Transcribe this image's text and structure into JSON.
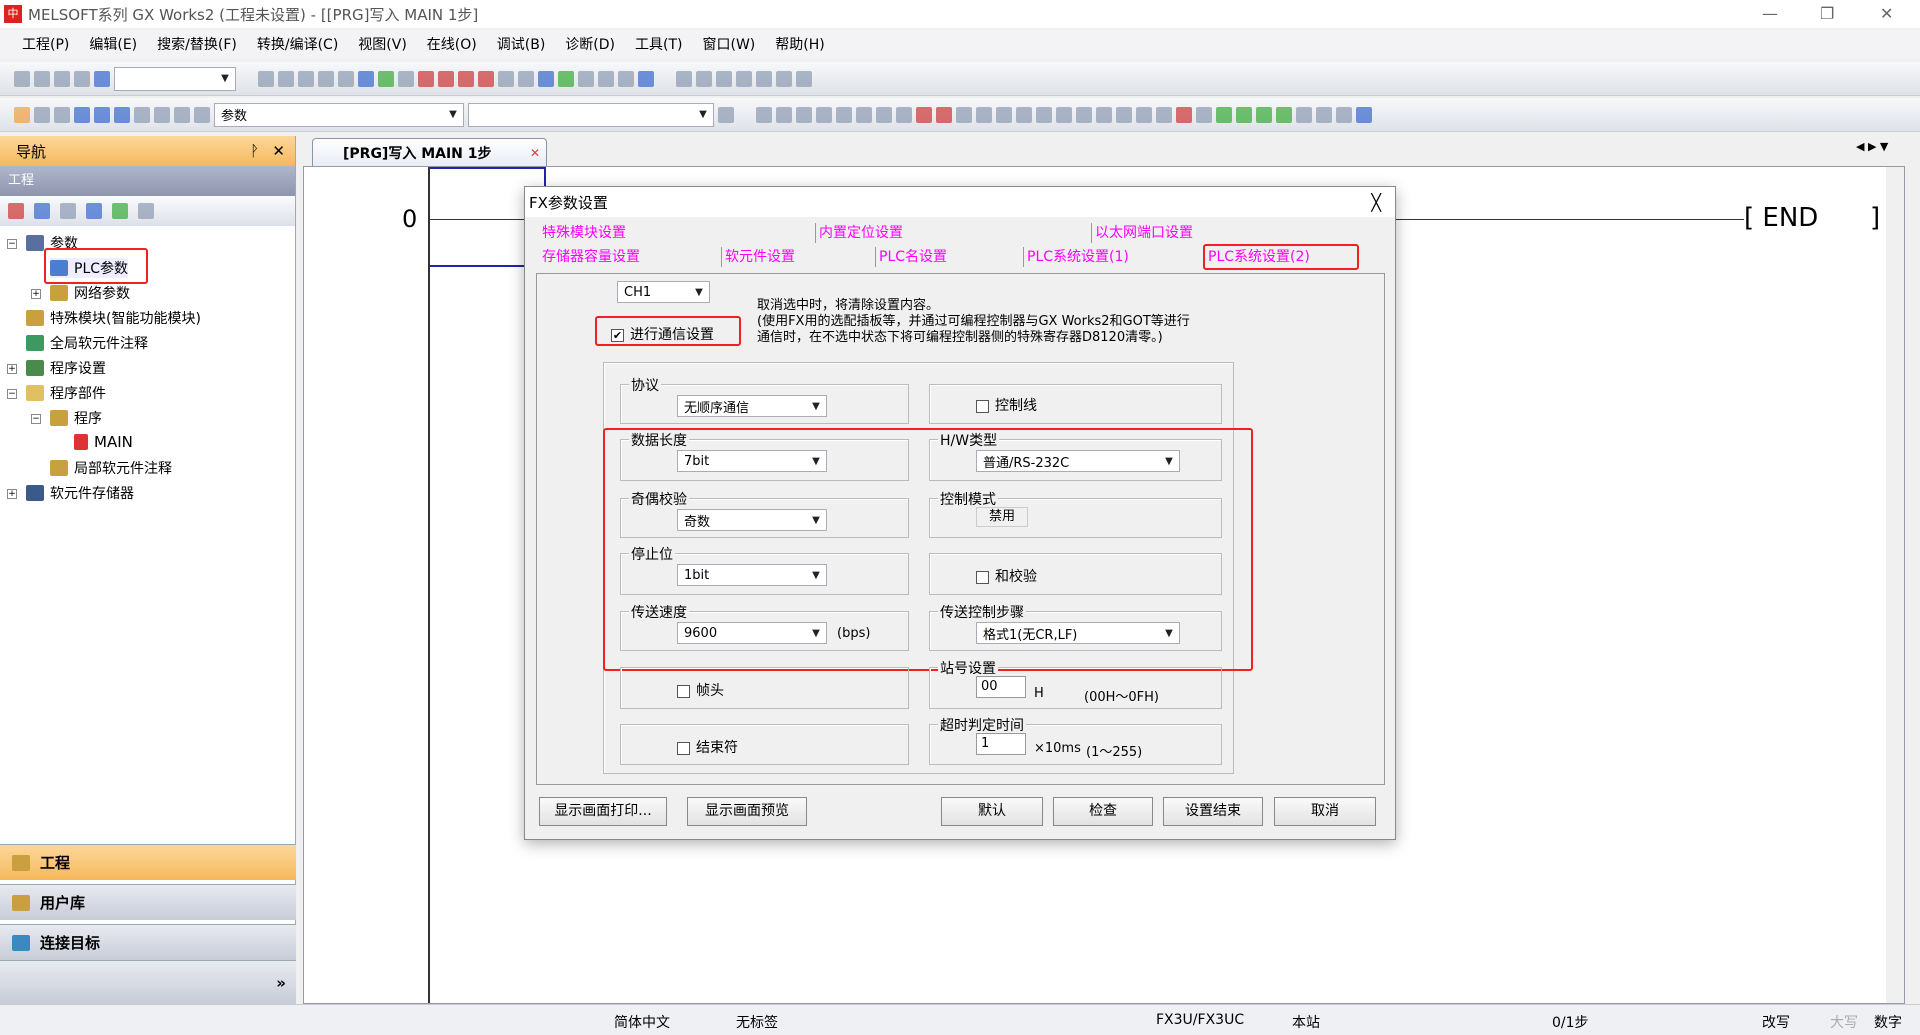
{
  "window": {
    "title": "MELSOFT系列 GX Works2 (工程未设置) - [[PRG]写入 MAIN 1步]",
    "min": "—",
    "restore": "❐",
    "close": "✕"
  },
  "menu": [
    "工程(P)",
    "编辑(E)",
    "搜索/替换(F)",
    "转换/编译(C)",
    "视图(V)",
    "在线(O)",
    "调试(B)",
    "诊断(D)",
    "工具(T)",
    "窗口(W)",
    "帮助(H)"
  ],
  "toolbar": {
    "combo1": "",
    "combo2": "参数",
    "combo3": ""
  },
  "nav": {
    "title": "导航",
    "pin": "ᚹ",
    "close": "✕",
    "section": "工程",
    "tree": [
      "参数",
      "PLC参数",
      "网络参数",
      "特殊模块(智能功能模块)",
      "全局软元件注释",
      "程序设置",
      "程序部件",
      "程序",
      "MAIN",
      "局部软元件注释",
      "软元件存储器"
    ],
    "bottom": [
      "工程",
      "用户库",
      "连接目标"
    ],
    "more": "»"
  },
  "doc_tab": {
    "label": "[PRG]写入 MAIN 1步",
    "close": "✕"
  },
  "ladder": {
    "step": "0",
    "end": "END"
  },
  "dialog": {
    "title": "FX参数设置",
    "close": "╳",
    "tabs_row1": [
      "特殊模块设置",
      "内置定位设置",
      "以太网端口设置"
    ],
    "tabs_row2": [
      "存储器容量设置",
      "软元件设置",
      "PLC名设置",
      "PLC系统设置(1)",
      "PLC系统设置(2)"
    ],
    "channel": "CH1",
    "comm_checkbox": {
      "label": "进行通信设置",
      "checked": true
    },
    "note": [
      "取消选中时，将清除设置内容。",
      "(使用FX用的选配插板等，并通过可编程控制器与GX Works2和GOT等进行",
      "通信时，在不选中状态下将可编程控制器侧的特殊寄存器D8120清零。)"
    ],
    "protocol": {
      "label": "协议",
      "value": "无顺序通信"
    },
    "control_line": {
      "label": "控制线",
      "checked": false
    },
    "data_length": {
      "label": "数据长度",
      "value": "7bit"
    },
    "hw_type": {
      "label": "H/W类型",
      "value": "普通/RS-232C"
    },
    "parity": {
      "label": "奇偶校验",
      "value": "奇数"
    },
    "control_mode": {
      "label": "控制模式",
      "value": "禁用"
    },
    "stop_bit": {
      "label": "停止位",
      "value": "1bit"
    },
    "sum_check": {
      "label": "和校验",
      "checked": false
    },
    "baud": {
      "label": "传送速度",
      "value": "9600",
      "unit": "(bps)"
    },
    "transfer_control": {
      "label": "传送控制步骤",
      "value": "格式1(无CR,LF)"
    },
    "header": {
      "label": "帧头",
      "checked": false
    },
    "station": {
      "label": "站号设置",
      "value": "00",
      "unit": "H",
      "range": "(00H～0FH)"
    },
    "terminator": {
      "label": "结束符",
      "checked": false
    },
    "timeout": {
      "label": "超时判定时间",
      "value": "1",
      "unit": "×10ms",
      "range": "(1～255)"
    },
    "buttons": [
      "显示画面打印...",
      "显示画面预览",
      "默认",
      "检查",
      "设置结束",
      "取消"
    ]
  },
  "status": [
    "简体中文",
    "无标签",
    "FX3U/FX3UC",
    "本站",
    "0/1步",
    "改写",
    "大写",
    "数字"
  ],
  "colors": {
    "tab_text": "#ff00ff",
    "highlight": "#e22222",
    "nav_header": "#f5b85c"
  }
}
